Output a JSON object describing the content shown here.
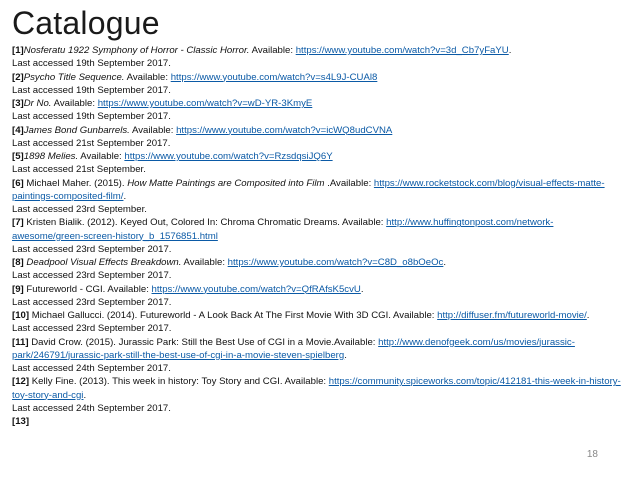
{
  "title": "Catalogue",
  "page_number": "18",
  "refs": [
    {
      "num": "[1]",
      "pre": "",
      "italic": "Nosferatu 1922 Symphony of Horror - Classic Horror.",
      "post": " Available: ",
      "url": "https://www.youtube.com/watch?v=3d_Cb7yFaYU",
      "end": ".",
      "accessed": "Last accessed 19th September 2017."
    },
    {
      "num": "[2]",
      "pre": "",
      "italic": "Psycho Title Sequence.",
      "post": " Available: ",
      "url": "https://www.youtube.com/watch?v=s4L9J-CUAl8",
      "end": "",
      "accessed": "Last accessed 19th September 2017."
    },
    {
      "num": "[3]",
      "pre": "",
      "italic": "Dr No.",
      "post": " Available: ",
      "url": "https://www.youtube.com/watch?v=wD-YR-3KmyE",
      "end": "",
      "accessed": "Last accessed 19th September 2017."
    },
    {
      "num": "[4]",
      "pre": "",
      "italic": "James Bond Gunbarrels.",
      "post": " Available: ",
      "url": "https://www.youtube.com/watch?v=icWQ8udCVNA",
      "end": "",
      "accessed": "Last accessed 21st September 2017."
    },
    {
      "num": "[5]",
      "pre": "",
      "italic": "1898 Melies.",
      "post": " Available: ",
      "url": "https://www.youtube.com/watch?v=RzsdqsiJQ6Y",
      "end": "",
      "accessed": "Last accessed 21st September."
    },
    {
      "num": "[6]",
      "pre": " Michael Maher. (2015). ",
      "italic": "How Matte Paintings are Composited into Film",
      "post": " .Available: ",
      "url": "https://www.rocketstock.com/blog/visual-effects-matte-paintings-composited-film/",
      "end": ".",
      "accessed": "Last accessed 23rd September."
    },
    {
      "num": "[7]",
      "pre": " Kristen Bialik. (2012). Keyed Out, Colored In: Chroma Chromatic Dreams. Available: ",
      "italic": "",
      "post": "",
      "url": "http://www.huffingtonpost.com/network-awesome/green-screen-history_b_1576851.html",
      "end": "",
      "accessed": "Last accessed 23rd September 2017."
    },
    {
      "num": "[8]",
      "pre": " ",
      "italic": "Deadpool Visual Effects Breakdown.",
      "post": " Available: ",
      "url": "https://www.youtube.com/watch?v=C8D_o8bOeOc",
      "end": ".",
      "accessed": "Last accessed 23rd September 2017."
    },
    {
      "num": "[9]",
      "pre": " Futureworld - CGI. Available: ",
      "italic": "",
      "post": "",
      "url": "https://www.youtube.com/watch?v=QfRAfsK5cvU",
      "end": ".",
      "accessed": "Last accessed 23rd September 2017."
    },
    {
      "num": "[10]",
      "pre": " Michael Gallucci. (2014). Futureworld - A Look Back At The First Movie With 3D CGI. Available: ",
      "italic": "",
      "post": "",
      "url": "http://diffuser.fm/futureworld-movie/",
      "end": ".",
      "accessed": "Last accessed 23rd September 2017."
    },
    {
      "num": "[11]",
      "pre": " David Crow. (2015). Jurassic Park: Still the Best Use of CGI in a Movie.Available: ",
      "italic": "",
      "post": "",
      "url": "http://www.denofgeek.com/us/movies/jurassic-park/246791/jurassic-park-still-the-best-use-of-cgi-in-a-movie-steven-spielberg",
      "end": ".",
      "accessed": "Last accessed 24th September 2017."
    },
    {
      "num": "[12]",
      "pre": " Kelly Fine. (2013). This week in history: Toy Story and CGI. Available: ",
      "italic": "",
      "post": "",
      "url": "https://community.spiceworks.com/topic/412181-this-week-in-history-toy-story-and-cgi",
      "end": ".",
      "accessed": "Last accessed 24th September 2017."
    },
    {
      "num": "[13]",
      "pre": "",
      "italic": "",
      "post": "",
      "url": "",
      "end": "",
      "accessed": ""
    }
  ]
}
